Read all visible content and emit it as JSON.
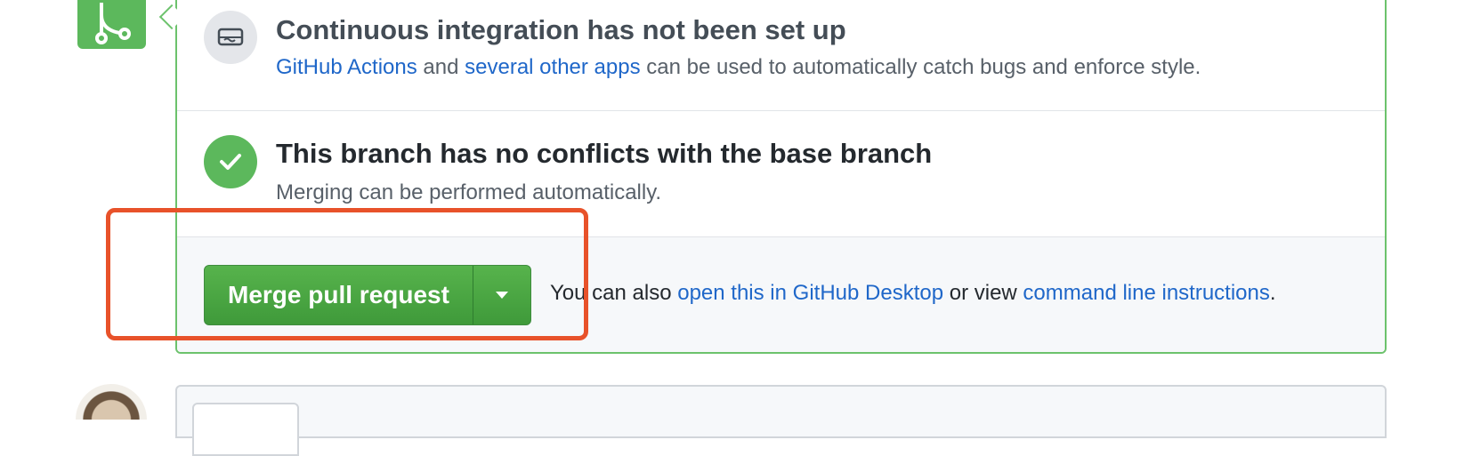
{
  "colors": {
    "green": "#5cb85c",
    "link": "#1f67c9",
    "highlight": "#e8522a",
    "border_green": "#6cc26c"
  },
  "icons": {
    "merge": "git-merge-icon",
    "ci": "server-icon",
    "check": "check-icon",
    "caret": "triangle-down-icon"
  },
  "ci_section": {
    "title": "Continuous integration has not been set up",
    "link_actions": "GitHub Actions",
    "text_and": " and ",
    "link_apps": "several other apps",
    "text_rest": " can be used to automatically catch bugs and enforce style."
  },
  "conflict_section": {
    "title": "This branch has no conflicts with the base branch",
    "description": "Merging can be performed automatically."
  },
  "merge_section": {
    "button_label": "Merge pull request",
    "text_prefix": "You can also ",
    "link_desktop": "open this in GitHub Desktop",
    "text_middle": " or view ",
    "link_cli": "command line instructions",
    "text_suffix": "."
  }
}
